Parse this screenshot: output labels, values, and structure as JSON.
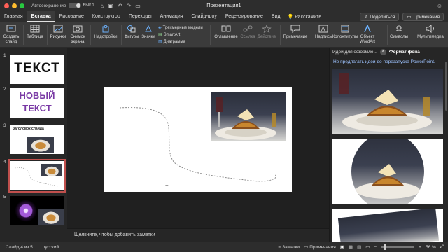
{
  "window": {
    "autosave_label": "Автосохранение",
    "autosave_state": "ВЫКЛ.",
    "doc_title": "Презентация1"
  },
  "menu": {
    "tabs": [
      "Главная",
      "Вставка",
      "Рисование",
      "Конструктор",
      "Переходы",
      "Анимация",
      "Слайд-шоу",
      "Рецензирование",
      "Вид"
    ],
    "active_tab": "Вставка",
    "tell_me": "Расскажите",
    "share_label": "Поделиться",
    "comments_label": "Примечания"
  },
  "ribbon": {
    "new_slide": "Создать слайд",
    "table": "Таблица",
    "pictures": "Рисунки",
    "screenshot": "Снимок экрана",
    "addins": "Надстройки",
    "shapes": "Фигуры",
    "icons": "Значки",
    "models3d": "Трехмерные модели",
    "smartart": "SmartArt",
    "chart": "Диаграмма",
    "toc": "Оглавление",
    "link": "Ссылка",
    "action": "Действие",
    "comment": "Примечание",
    "textbox": "Надпись",
    "header_footer": "Колонтитулы",
    "wordart": "Объект WordArt",
    "symbols": "Символы",
    "media": "Мультимедиа"
  },
  "thumbnails": [
    {
      "num": "1",
      "text": "ТЕКСТ"
    },
    {
      "num": "2",
      "text_line1": "НОВЫЙ",
      "text_line2": "ТЕКСТ"
    },
    {
      "num": "3",
      "title": "Заголовок слайда"
    },
    {
      "num": "4"
    },
    {
      "num": "5"
    }
  ],
  "notes_placeholder": "Щелкните, чтобы добавить заметки",
  "pane": {
    "tab_ideas": "Идеи для оформле...",
    "tab_format": "Формат фона",
    "link": "Не предлагать идеи до перезапуска PowerPoint."
  },
  "status": {
    "slide_info": "Слайд 4 из 5",
    "language": "русский",
    "notes_btn": "Заметки",
    "comments_btn": "Примечания",
    "zoom": "56 %"
  },
  "colors": {
    "accent_selected": "#c0504d",
    "ribbon_bg": "#3b3b3b",
    "link": "#9ec3ff"
  }
}
